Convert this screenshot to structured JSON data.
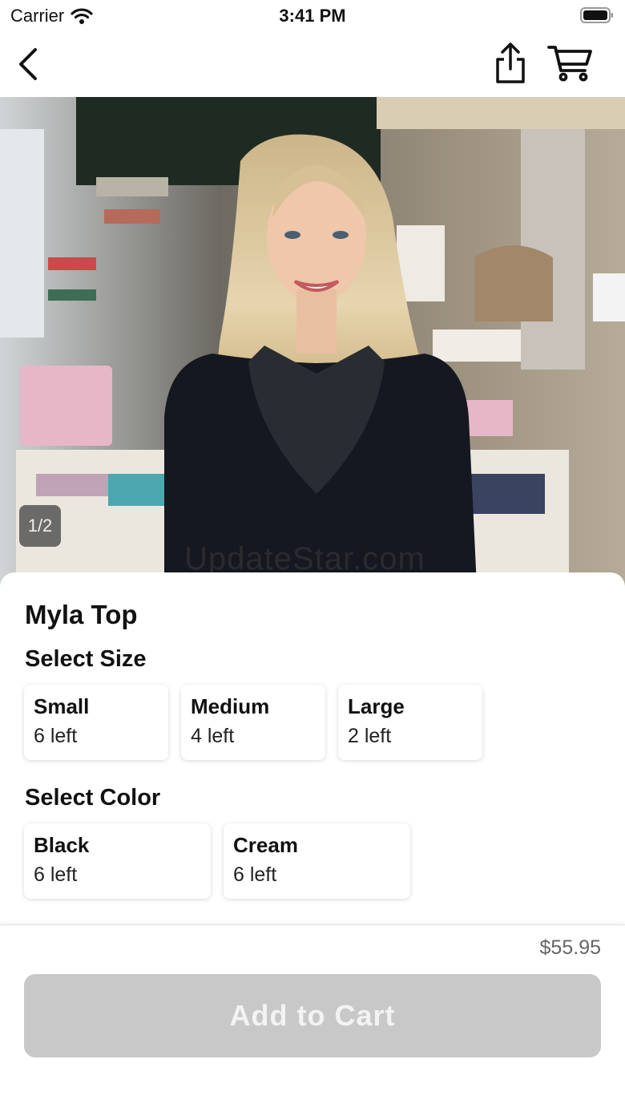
{
  "status_bar": {
    "carrier": "Carrier",
    "time": "3:41 PM"
  },
  "nav": {
    "back_icon": "chevron-left-icon",
    "share_icon": "share-icon",
    "cart_icon": "cart-icon"
  },
  "photo": {
    "page_indicator": "1/2",
    "watermark": "UpdateStar.com"
  },
  "product": {
    "title": "Myla Top"
  },
  "size_section": {
    "title": "Select Size",
    "options": [
      {
        "name": "Small",
        "stock": "6 left"
      },
      {
        "name": "Medium",
        "stock": "4 left"
      },
      {
        "name": "Large",
        "stock": "2 left"
      }
    ]
  },
  "color_section": {
    "title": "Select Color",
    "options": [
      {
        "name": "Black",
        "stock": "6 left"
      },
      {
        "name": "Cream",
        "stock": "6 left"
      }
    ]
  },
  "footer": {
    "price": "$55.95",
    "add_to_cart": "Add to Cart"
  },
  "colors": {
    "button_disabled": "#c8c8c8",
    "price_text": "#666666"
  }
}
